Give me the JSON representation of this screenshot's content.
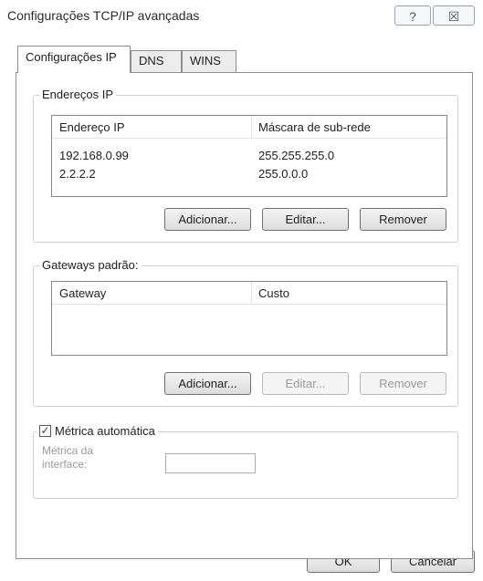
{
  "window": {
    "title": "Configurações TCP/IP avançadas",
    "help_glyph": "?",
    "close_glyph": "☒"
  },
  "tabs": [
    {
      "label": "Configurações IP",
      "active": true
    },
    {
      "label": "DNS",
      "active": false
    },
    {
      "label": "WINS",
      "active": false
    }
  ],
  "ip_addresses": {
    "group_label": "Endereços IP",
    "columns": [
      "Endereço IP",
      "Máscara de sub-rede"
    ],
    "rows": [
      [
        "192.168.0.99",
        "255.255.255.0"
      ],
      [
        "2.2.2.2",
        "255.0.0.0"
      ]
    ],
    "add_label": "Adicionar...",
    "edit_label": "Editar...",
    "remove_label": "Remover"
  },
  "gateways": {
    "group_label": "Gateways padrão:",
    "columns": [
      "Gateway",
      "Custo"
    ],
    "add_label": "Adicionar...",
    "edit_label": "Editar...",
    "remove_label": "Remover"
  },
  "metric": {
    "auto_label": "Métrica automática",
    "auto_checked": true,
    "check_glyph": "✓",
    "interface_label_line1": "Métrica da",
    "interface_label_line2": "interface:",
    "interface_value": ""
  },
  "footer": {
    "ok_label": "OK",
    "cancel_label": "Cancelar"
  }
}
